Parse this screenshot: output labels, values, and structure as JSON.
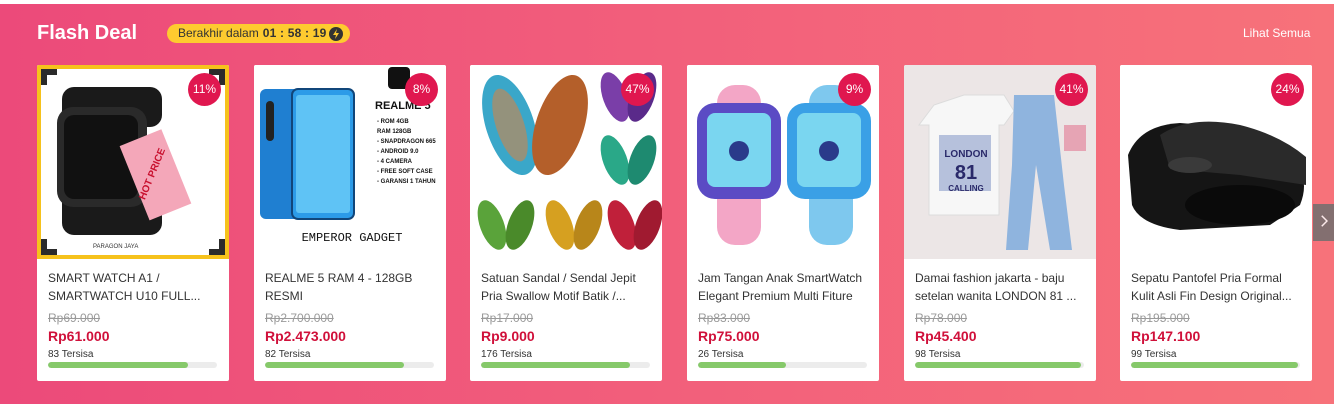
{
  "header": {
    "title": "Flash Deal",
    "timer_label": "Berakhir dalam",
    "timer_value": "01 : 58 : 19",
    "see_all": "Lihat Semua"
  },
  "colors": {
    "banner_start": "#ec4a7a",
    "banner_end": "#f7727a",
    "badge": "#e0174f",
    "price": "#d0103a",
    "progress": "#86c96a",
    "timer_bg": "#fecb2f"
  },
  "products": [
    {
      "discount": "11%",
      "name": "SMART WATCH A1 / SMARTWATCH U10 FULL...",
      "old_price": "Rp69.000",
      "price": "Rp61.000",
      "stock": "83 Tersisa",
      "progress": 0.83,
      "image": {
        "brand_text": "PARAGON JAYA",
        "tag_text": "HOT PRICE"
      }
    },
    {
      "discount": "8%",
      "name": "REALME 5 RAM 4 - 128GB RESMI",
      "old_price": "Rp2.700.000",
      "price": "Rp2.473.000",
      "stock": "82 Tersisa",
      "progress": 0.82,
      "image": {
        "heading": "REALME 5",
        "specs": [
          "- ROM 4GB",
          "RAM 128GB",
          "- SNAPDRAGON 665",
          "- ANDROID 9.0",
          "- 4 CAMERA",
          "- FREE SOFT CASE",
          "- GARANSI 1 TAHUN"
        ],
        "store": "EMPEROR GADGET"
      }
    },
    {
      "discount": "47%",
      "name": "Satuan Sandal / Sendal Jepit Pria Swallow Motif Batik /...",
      "old_price": "Rp17.000",
      "price": "Rp9.000",
      "stock": "176 Tersisa",
      "progress": 0.88
    },
    {
      "discount": "9%",
      "name": "Jam Tangan Anak SmartWatch Elegant Premium Multi Fiture",
      "old_price": "Rp83.000",
      "price": "Rp75.000",
      "stock": "26 Tersisa",
      "progress": 0.52
    },
    {
      "discount": "41%",
      "name": "Damai fashion jakarta - baju setelan wanita LONDON 81 ...",
      "old_price": "Rp78.000",
      "price": "Rp45.400",
      "stock": "98 Tersisa",
      "progress": 0.98,
      "image": {
        "shirt_text": [
          "LONDON",
          "81",
          "CALLING"
        ]
      }
    },
    {
      "discount": "24%",
      "name": "Sepatu Pantofel Pria Formal Kulit Asli Fin Design Original...",
      "old_price": "Rp195.000",
      "price": "Rp147.100",
      "stock": "99 Tersisa",
      "progress": 0.99
    }
  ]
}
